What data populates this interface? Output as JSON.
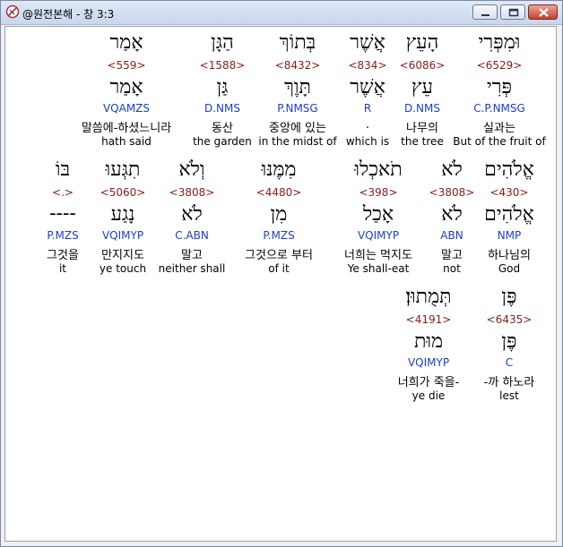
{
  "window": {
    "title": "@원전본해 - 창 3:3"
  },
  "rows": [
    [
      {
        "heb": "וּמִפְּרִי",
        "num": "<6529>",
        "lex": "פְּרִי",
        "parse": "C.P.NMSG",
        "kor": "실과는",
        "eng": "But of the fruit of"
      },
      {
        "heb": "הָעֵץ",
        "num": "<6086>",
        "lex": "עֵץ",
        "parse": "D.NMS",
        "kor": "나무의",
        "eng": "the tree"
      },
      {
        "heb": "אֲשֶׁר",
        "num": "<834>",
        "lex": "אֲשֶׁר",
        "parse": "R",
        "kor": ".",
        "eng": "which is"
      },
      {
        "heb": "בְּתוֹךְ",
        "num": "<8432>",
        "lex": "תָּוֶךְ",
        "parse": "P.NMSG",
        "kor": "중앙에 있는",
        "eng": "in the midst of"
      },
      {
        "heb": "הַגָּן",
        "num": "<1588>",
        "lex": "גַּן",
        "parse": "D.NMS",
        "kor": "동산",
        "eng": "the garden"
      },
      {
        "heb": "אָמַר",
        "num": "<559>",
        "lex": "אָמַר",
        "parse": "VQAMZS",
        "kor": "말씀에-하셨느니라",
        "eng": "hath said"
      }
    ],
    [
      {
        "heb": "אֱלֹהִים",
        "num": "<430>",
        "lex": "אֱלֹהִים",
        "parse": "NMP",
        "kor": "하나님의",
        "eng": "God"
      },
      {
        "heb": "לֹא",
        "num": "<3808>",
        "lex": "לֹא",
        "parse": "ABN",
        "kor": "말고",
        "eng": "not"
      },
      {
        "heb": "תֹאכְלוּ",
        "num": "<398>",
        "lex": "אָכַל",
        "parse": "VQIMYP",
        "kor": "너희는 먹지도",
        "eng": "Ye shall-eat"
      },
      {
        "heb": "מִמֶּנּוּ",
        "num": "<4480>",
        "lex": "מִן",
        "parse": "P.MZS",
        "kor": "그것으로 부터",
        "eng": "of it"
      },
      {
        "heb": "וְלֹא",
        "num": "<3808>",
        "lex": "לֹא",
        "parse": "C.ABN",
        "kor": "말고",
        "eng": "neither shall"
      },
      {
        "heb": "תִגְּעוּ",
        "num": "<5060>",
        "lex": "נָגַע",
        "parse": "VQIMYP",
        "kor": "만지지도",
        "eng": "ye touch"
      },
      {
        "heb": "בּוֹ",
        "num": "<.>",
        "lex": "----",
        "parse": "P.MZS",
        "kor": "그것을",
        "eng": "it"
      }
    ],
    [
      {
        "heb": "פֶּן",
        "num": "<6435>",
        "lex": "פֶּן",
        "parse": "C",
        "kor": "-까 하노라",
        "eng": "lest"
      },
      {
        "heb": "תְּמֻתוּן׃",
        "num": "<4191>",
        "lex": "מוּת",
        "parse": "VQIMYP",
        "kor": "너희가 죽을-",
        "eng": "ye die"
      }
    ]
  ]
}
